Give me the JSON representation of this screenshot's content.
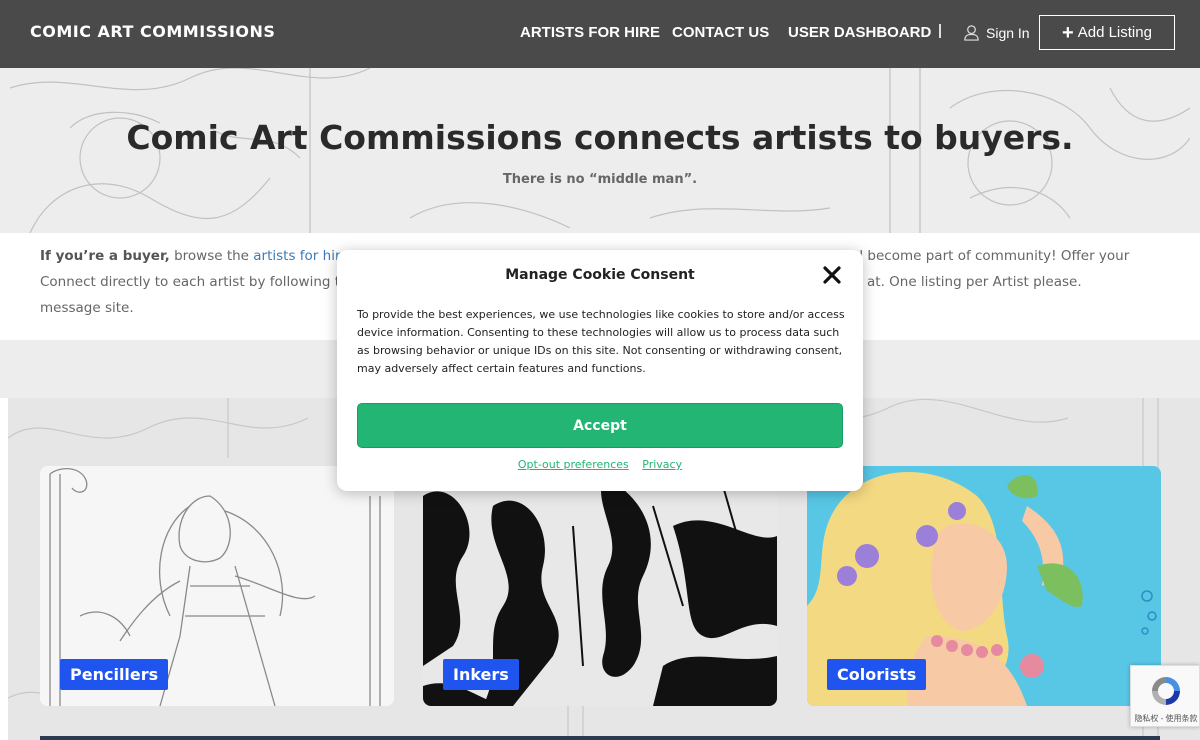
{
  "header": {
    "logo": "COMIC ART COMMISSIONS",
    "nav": [
      "ARTISTS FOR HIRE",
      "CONTACT US",
      "USER DASHBOARD"
    ],
    "separator": "|",
    "sign_in": "Sign In",
    "add_listing": "Add Listing"
  },
  "hero": {
    "title": "Comic Art Commissions connects artists to buyers.",
    "subtitle": "There is no “middle man”."
  },
  "intro": {
    "line1_bold": "If you’re a buyer,",
    "line1_text": " browse the ",
    "line1_link": "artists for hire",
    "line1_end": ".",
    "line1_right": "nd become part of community! Offer your",
    "line2_left": "Connect directly to each artist by following the",
    "line2_right": "at. One listing per Artist please.",
    "line3": "message site."
  },
  "cards": [
    {
      "label": "Pencillers"
    },
    {
      "label": "Inkers"
    },
    {
      "label": "Colorists"
    }
  ],
  "cookie": {
    "title": "Manage Cookie Consent",
    "body": "To provide the best experiences, we use technologies like cookies to store and/or access device information. Consenting to these technologies will allow us to process data such as browsing behavior or unique IDs on this site. Not consenting or withdrawing consent, may adversely affect certain features and functions.",
    "accept": "Accept",
    "link_optout": "Opt-out preferences",
    "link_privacy": "Privacy"
  },
  "recaptcha": {
    "text": "隐私权 - 使用条款"
  },
  "colors": {
    "header_bg": "#4a4a4a",
    "accent_blue": "#1f55ee",
    "accept_green": "#22b573",
    "link_blue": "#3d7ab8"
  }
}
